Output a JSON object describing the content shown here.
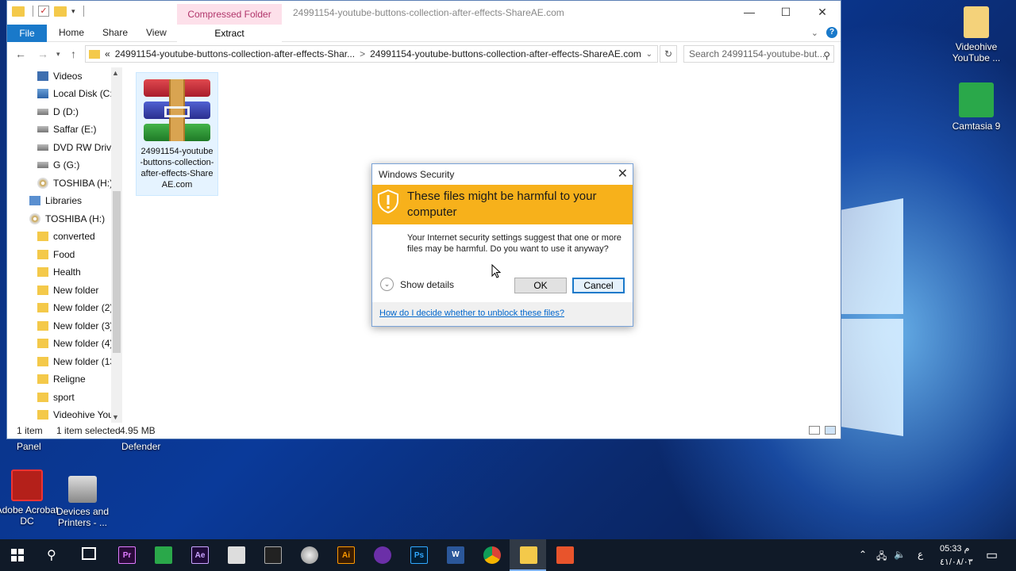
{
  "window": {
    "title": "24991154-youtube-buttons-collection-after-effects-ShareAE.com",
    "context_tab": "Compressed Folder Tools",
    "context_subtab": "Extract",
    "minimize": "—",
    "maximize": "☐",
    "close": "✕"
  },
  "ribbon": {
    "tabs": [
      "File",
      "Home",
      "Share",
      "View"
    ]
  },
  "address": {
    "prefix": "«",
    "crumb1": "24991154-youtube-buttons-collection-after-effects-Shar...",
    "separator": ">",
    "crumb2": "24991154-youtube-buttons-collection-after-effects-ShareAE.com",
    "search_placeholder": "Search 24991154-youtube-but..."
  },
  "nav": {
    "items": [
      {
        "label": "Videos",
        "icon": "video-icon"
      },
      {
        "label": "Local Disk (C:)",
        "icon": "system-drive-icon"
      },
      {
        "label": "D (D:)",
        "icon": "drive-icon"
      },
      {
        "label": "Saffar (E:)",
        "icon": "drive-icon"
      },
      {
        "label": "DVD RW Drive",
        "icon": "dvd-drive-icon"
      },
      {
        "label": "G (G:)",
        "icon": "drive-icon"
      },
      {
        "label": "TOSHIBA (H:)",
        "icon": "media-drive-icon"
      },
      {
        "label": "Libraries",
        "icon": "libraries-icon"
      },
      {
        "label": "TOSHIBA (H:)",
        "icon": "media-drive-icon"
      },
      {
        "label": "converted",
        "icon": "folder-icon"
      },
      {
        "label": "Food",
        "icon": "folder-icon"
      },
      {
        "label": "Health",
        "icon": "folder-icon"
      },
      {
        "label": "New folder",
        "icon": "folder-icon"
      },
      {
        "label": "New folder (2)",
        "icon": "folder-icon"
      },
      {
        "label": "New folder (3)",
        "icon": "folder-icon"
      },
      {
        "label": "New folder (4)",
        "icon": "folder-icon"
      },
      {
        "label": "New folder (13",
        "icon": "folder-icon"
      },
      {
        "label": "Religne",
        "icon": "folder-icon"
      },
      {
        "label": "sport",
        "icon": "folder-icon"
      },
      {
        "label": "Videohive You'",
        "icon": "folder-icon"
      }
    ]
  },
  "content": {
    "file_name": "24991154-youtube-buttons-collection-after-effects-ShareAE.com"
  },
  "status": {
    "count": "1 item",
    "selected": "1 item selected",
    "size": "4.95 MB"
  },
  "dialog": {
    "title": "Windows Security",
    "heading": "These files might be harmful to your computer",
    "body": "Your Internet security settings suggest that one or more files may be harmful. Do you want to use it anyway?",
    "show_details": "Show details",
    "ok": "OK",
    "cancel": "Cancel",
    "link": "How do I decide whether to unblock these files?"
  },
  "desktop": {
    "icons": [
      {
        "label": "Videohive YouTube ..."
      },
      {
        "label": "Camtasia 9"
      },
      {
        "label": "Adobe Acrobat DC"
      },
      {
        "label": "Devices and Printers - ..."
      }
    ],
    "partial_labels": [
      "Panel",
      "Defender"
    ]
  },
  "taskbar": {
    "apps": [
      "Pr",
      "Ae",
      "Ai",
      "Ps",
      "W"
    ],
    "clock_time": "05:33 م",
    "clock_date": "٤١/٠٨/٠٣",
    "lang": "ع"
  },
  "colors": {
    "accent": "#1979ca",
    "warning_banner": "#f7b11b",
    "context_tab_bg": "#fde0ea"
  }
}
